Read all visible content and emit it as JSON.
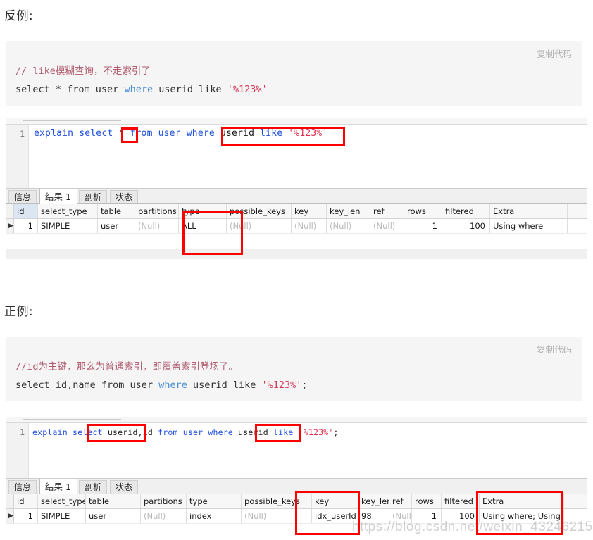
{
  "headings": {
    "bad_example": "反例:",
    "good_example": "正例:"
  },
  "code_blocks": {
    "bad": {
      "copy_label": "复制代码",
      "comment": "// like模糊查询，不走索引了",
      "sql_plain_1": "select * from user ",
      "sql_kw_where": "where",
      "sql_plain_2": " userid like ",
      "sql_string": "'%123%'",
      "sql_tail": ""
    },
    "good": {
      "copy_label": "复制代码",
      "comment": "//id为主键，那么为普通索引，即覆盖索引登场了。",
      "sql_plain_1": "select id,name from user ",
      "sql_kw_where": "where",
      "sql_plain_2": " userid like ",
      "sql_string": "'%123%'",
      "sql_tail": ";"
    }
  },
  "sql_editors": {
    "bad": {
      "line_number": "1",
      "kw_explain": "explain",
      "kw_select": "select",
      "ident_columns": "*",
      "kw_from": "from",
      "ident_table": "user",
      "kw_where": "where",
      "ident_field": "userid",
      "kw_like": "like",
      "str_pattern": "'%123%'",
      "terminator": ""
    },
    "good": {
      "line_number": "1",
      "kw_explain": "explain",
      "kw_select": "select",
      "ident_columns": "userid,id",
      "kw_from": "from",
      "ident_table": "user",
      "kw_where": "where",
      "ident_field": "userid",
      "kw_like": "like",
      "str_pattern": "'%123%'",
      "terminator": ";"
    }
  },
  "result_tabs": [
    {
      "label": "信息",
      "active": false
    },
    {
      "label": "结果 1",
      "active": true
    },
    {
      "label": "剖析",
      "active": false
    },
    {
      "label": "状态",
      "active": false
    }
  ],
  "grid_columns": [
    "id",
    "select_type",
    "table",
    "partitions",
    "type",
    "possible_keys",
    "key",
    "key_len",
    "ref",
    "rows",
    "filtered",
    "Extra"
  ],
  "results": {
    "bad": {
      "row_marker": "▶",
      "row": {
        "id": "1",
        "select_type": "SIMPLE",
        "table": "user",
        "partitions": "(Null)",
        "type": "ALL",
        "possible_keys": "(Null)",
        "key": "(Null)",
        "key_len": "(Null)",
        "ref": "(Null)",
        "rows": "1",
        "filtered": "100",
        "Extra": "Using where"
      }
    },
    "good": {
      "row_marker": "▶",
      "row": {
        "id": "1",
        "select_type": "SIMPLE",
        "table": "user",
        "partitions": "(Null)",
        "type": "index",
        "possible_keys": "(Null)",
        "key": "idx_userId",
        "key_len": "98",
        "ref": "(Null)",
        "rows": "1",
        "filtered": "100",
        "Extra": "Using where; Using index"
      }
    }
  },
  "watermark": {
    "text": "https://blog.csdn.net/weixin_43246215"
  },
  "colors": {
    "annotation": "#ff0000",
    "keyword": "#1f4fdd",
    "string": "#e03050",
    "comment": "#b05c6e",
    "code_background": "#f5f5f5"
  }
}
